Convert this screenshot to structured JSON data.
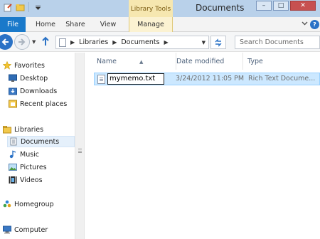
{
  "window": {
    "title": "Documents",
    "contextual_tab_group": "Library Tools",
    "buttons": {
      "minimize": "–",
      "maximize": "□",
      "close": "✕"
    }
  },
  "ribbon": {
    "tabs": [
      {
        "label": "File"
      },
      {
        "label": "Home"
      },
      {
        "label": "Share"
      },
      {
        "label": "View"
      },
      {
        "label": "Manage"
      }
    ]
  },
  "address": {
    "path": [
      "Libraries",
      "Documents"
    ],
    "search_placeholder": "Search Documents"
  },
  "navigation": {
    "items": [
      {
        "label": "Favorites",
        "icon": "star-icon"
      },
      {
        "label": "Desktop",
        "icon": "desktop-icon"
      },
      {
        "label": "Downloads",
        "icon": "downloads-icon"
      },
      {
        "label": "Recent places",
        "icon": "recent-places-icon"
      },
      {
        "label": "Libraries",
        "icon": "libraries-icon"
      },
      {
        "label": "Documents",
        "icon": "documents-icon",
        "selected": true
      },
      {
        "label": "Music",
        "icon": "music-icon"
      },
      {
        "label": "Pictures",
        "icon": "pictures-icon"
      },
      {
        "label": "Videos",
        "icon": "videos-icon"
      },
      {
        "label": "Homegroup",
        "icon": "homegroup-icon"
      },
      {
        "label": "Computer",
        "icon": "computer-icon"
      }
    ]
  },
  "file_list": {
    "columns": [
      "Name",
      "Date modified",
      "Type"
    ],
    "rows": [
      {
        "name": "mymemo.txt",
        "date_modified": "3/24/2012 11:05 PM",
        "type": "Rich Text Docume...",
        "renaming": true
      }
    ]
  },
  "colors": {
    "accent": "#1979ca",
    "title_bar": "#b9d1ea",
    "library_tools": "#f6e7b0",
    "selection": "#cce8ff"
  }
}
